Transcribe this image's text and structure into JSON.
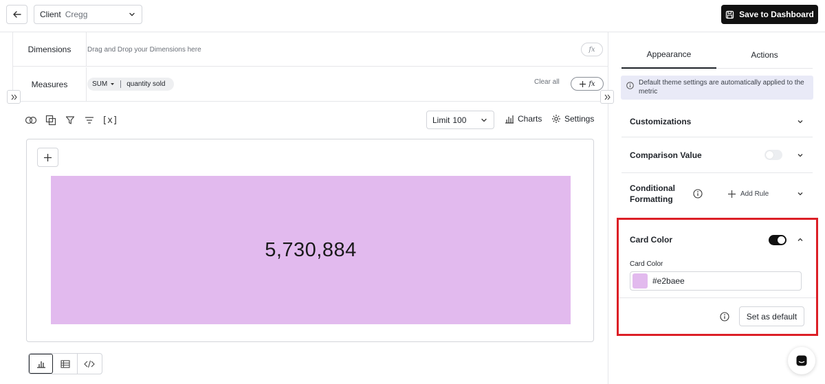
{
  "header": {
    "client_label": "Client",
    "client_value": "Cregg",
    "save_label": "Save to Dashboard"
  },
  "query": {
    "dimensions_label": "Dimensions",
    "dimensions_placeholder": "Drag and Drop your Dimensions here",
    "measures_label": "Measures",
    "measure_agg": "SUM",
    "measure_field": "quantity sold",
    "clear_all_label": "Clear all",
    "fx_symbol": "fx"
  },
  "toolbar": {
    "limit_label": "Limit",
    "limit_value": "100",
    "charts_label": "Charts",
    "settings_label": "Settings",
    "variable_label": "[x]"
  },
  "metric": {
    "value": "5,730,884",
    "card_color": "#e2baee"
  },
  "panel": {
    "tabs": [
      "Appearance",
      "Actions"
    ],
    "active_tab": "Appearance",
    "info_text": "Default theme settings are automatically applied to the metric",
    "sections": {
      "customizations": "Customizations",
      "comparison_value": "Comparison Value",
      "conditional_formatting": "Conditional Formatting",
      "add_rule": "Add Rule",
      "card_color": "Card Color"
    },
    "comparison_enabled": false,
    "card_color_enabled": true,
    "card_color_field_label": "Card Color",
    "card_color_value": "#e2baee",
    "set_default_label": "Set as default"
  },
  "colors": {
    "highlight": "#dc1f26",
    "accent_dark": "#111111",
    "info_bg": "#e9eaf7"
  }
}
